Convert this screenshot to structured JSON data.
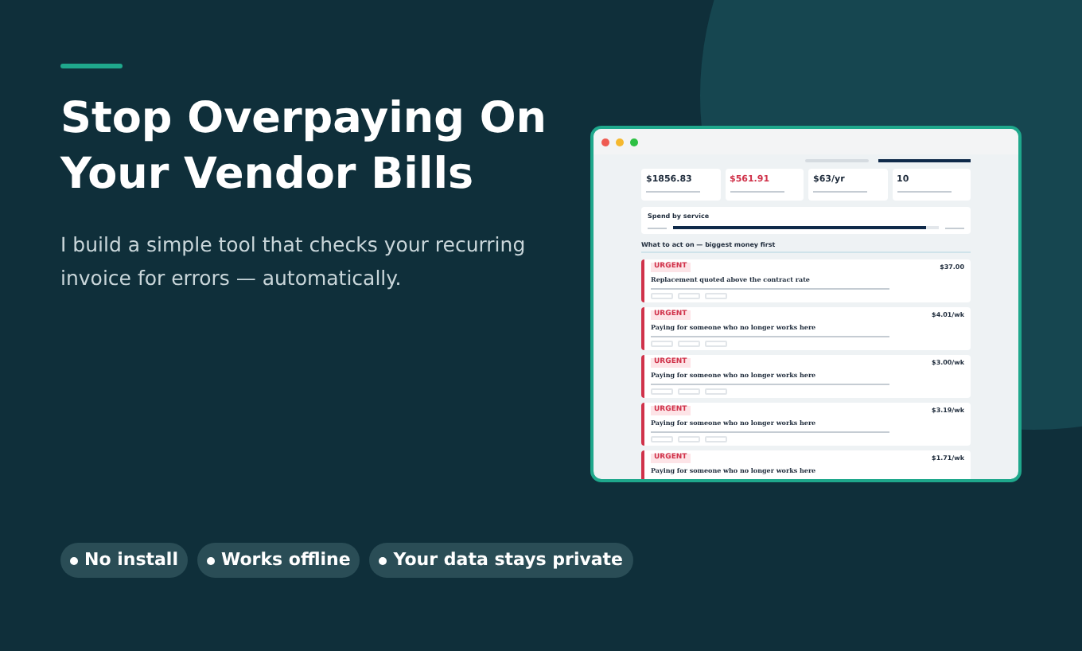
{
  "headline": "Stop Overpaying On Your Vendor Bills",
  "subtitle": "I build a simple tool that checks your recurring invoice for errors — automatically.",
  "features": [
    "No install",
    "Works offline",
    "Your data stays private"
  ],
  "app": {
    "stats": [
      {
        "value": "$1856.83",
        "alert": false
      },
      {
        "value": "$561.91",
        "alert": true
      },
      {
        "value": "$63/yr",
        "alert": false
      },
      {
        "value": "10",
        "alert": false
      }
    ],
    "spend_title": "Spend by service",
    "section_title": "What to act on — biggest money first",
    "issues": [
      {
        "badge": "URGENT",
        "title": "Replacement quoted above the contract rate",
        "amount": "$37.00"
      },
      {
        "badge": "URGENT",
        "title": "Paying for someone who no longer works here",
        "amount": "$4.01/wk"
      },
      {
        "badge": "URGENT",
        "title": "Paying for someone who no longer works here",
        "amount": "$3.00/wk"
      },
      {
        "badge": "URGENT",
        "title": "Paying for someone who no longer works here",
        "amount": "$3.19/wk"
      },
      {
        "badge": "URGENT",
        "title": "Paying for someone who no longer works here",
        "amount": "$1.71/wk"
      }
    ]
  }
}
